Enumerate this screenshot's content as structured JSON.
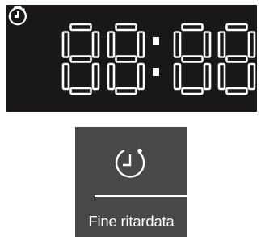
{
  "display": {
    "digits": [
      "8",
      "8",
      "8",
      "8"
    ],
    "separator": ":",
    "indicator_icons": [
      "end-time-clock-icon",
      "delay-clock-icon"
    ],
    "segment_color": "#ffffff",
    "background_color": "#1a1717"
  },
  "delay_end_button": {
    "icon": "delay-timer-icon",
    "label": "Fine ritardata",
    "background_color": "#484848"
  }
}
